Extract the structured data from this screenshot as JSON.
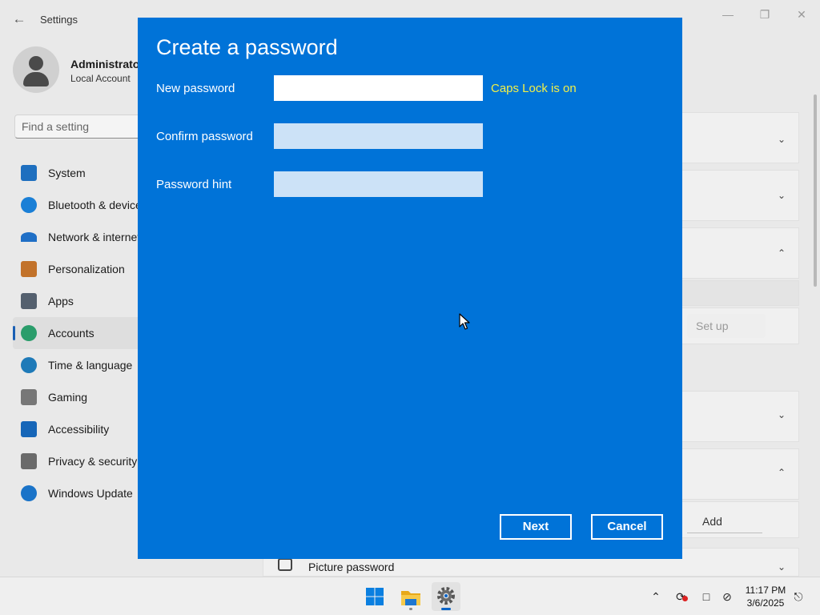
{
  "window": {
    "title": "Settings"
  },
  "user": {
    "name": "Administrator",
    "account_type": "Local Account"
  },
  "search": {
    "placeholder": "Find a setting"
  },
  "nav": [
    {
      "label": "System",
      "icon": "monitor-icon",
      "color": "#1e6fbf"
    },
    {
      "label": "Bluetooth & devices",
      "icon": "bluetooth-icon",
      "color": "#1a7fd6"
    },
    {
      "label": "Network & internet",
      "icon": "wifi-icon",
      "color": "#1f6fc6"
    },
    {
      "label": "Personalization",
      "icon": "brush-icon",
      "color": "#c2722a"
    },
    {
      "label": "Apps",
      "icon": "apps-icon",
      "color": "#54606e"
    },
    {
      "label": "Accounts",
      "icon": "person-icon",
      "color": "#2a9d6b",
      "active": true
    },
    {
      "label": "Time & language",
      "icon": "globe-clock-icon",
      "color": "#1e7ab8"
    },
    {
      "label": "Gaming",
      "icon": "gamepad-icon",
      "color": "#777777"
    },
    {
      "label": "Accessibility",
      "icon": "accessibility-icon",
      "color": "#1666b8"
    },
    {
      "label": "Privacy & security",
      "icon": "shield-icon",
      "color": "#6a6a6a"
    },
    {
      "label": "Windows Update",
      "icon": "refresh-icon",
      "color": "#1a73c8"
    }
  ],
  "right_panel": {
    "setup_label": "Set up",
    "add_label": "Add",
    "picture_password_label": "Picture password"
  },
  "dialog": {
    "title": "Create a password",
    "new_password_label": "New password",
    "new_password_value": "",
    "confirm_password_label": "Confirm password",
    "confirm_password_value": "",
    "hint_label": "Password hint",
    "hint_value": "",
    "caps_lock_warning": "Caps Lock is on",
    "next_label": "Next",
    "cancel_label": "Cancel"
  },
  "taskbar": {
    "time": "11:17 PM",
    "date": "3/6/2025"
  },
  "colors": {
    "dialog_bg": "#0073d8",
    "caps_warning": "#f2f048",
    "accent": "#0a64c8"
  }
}
